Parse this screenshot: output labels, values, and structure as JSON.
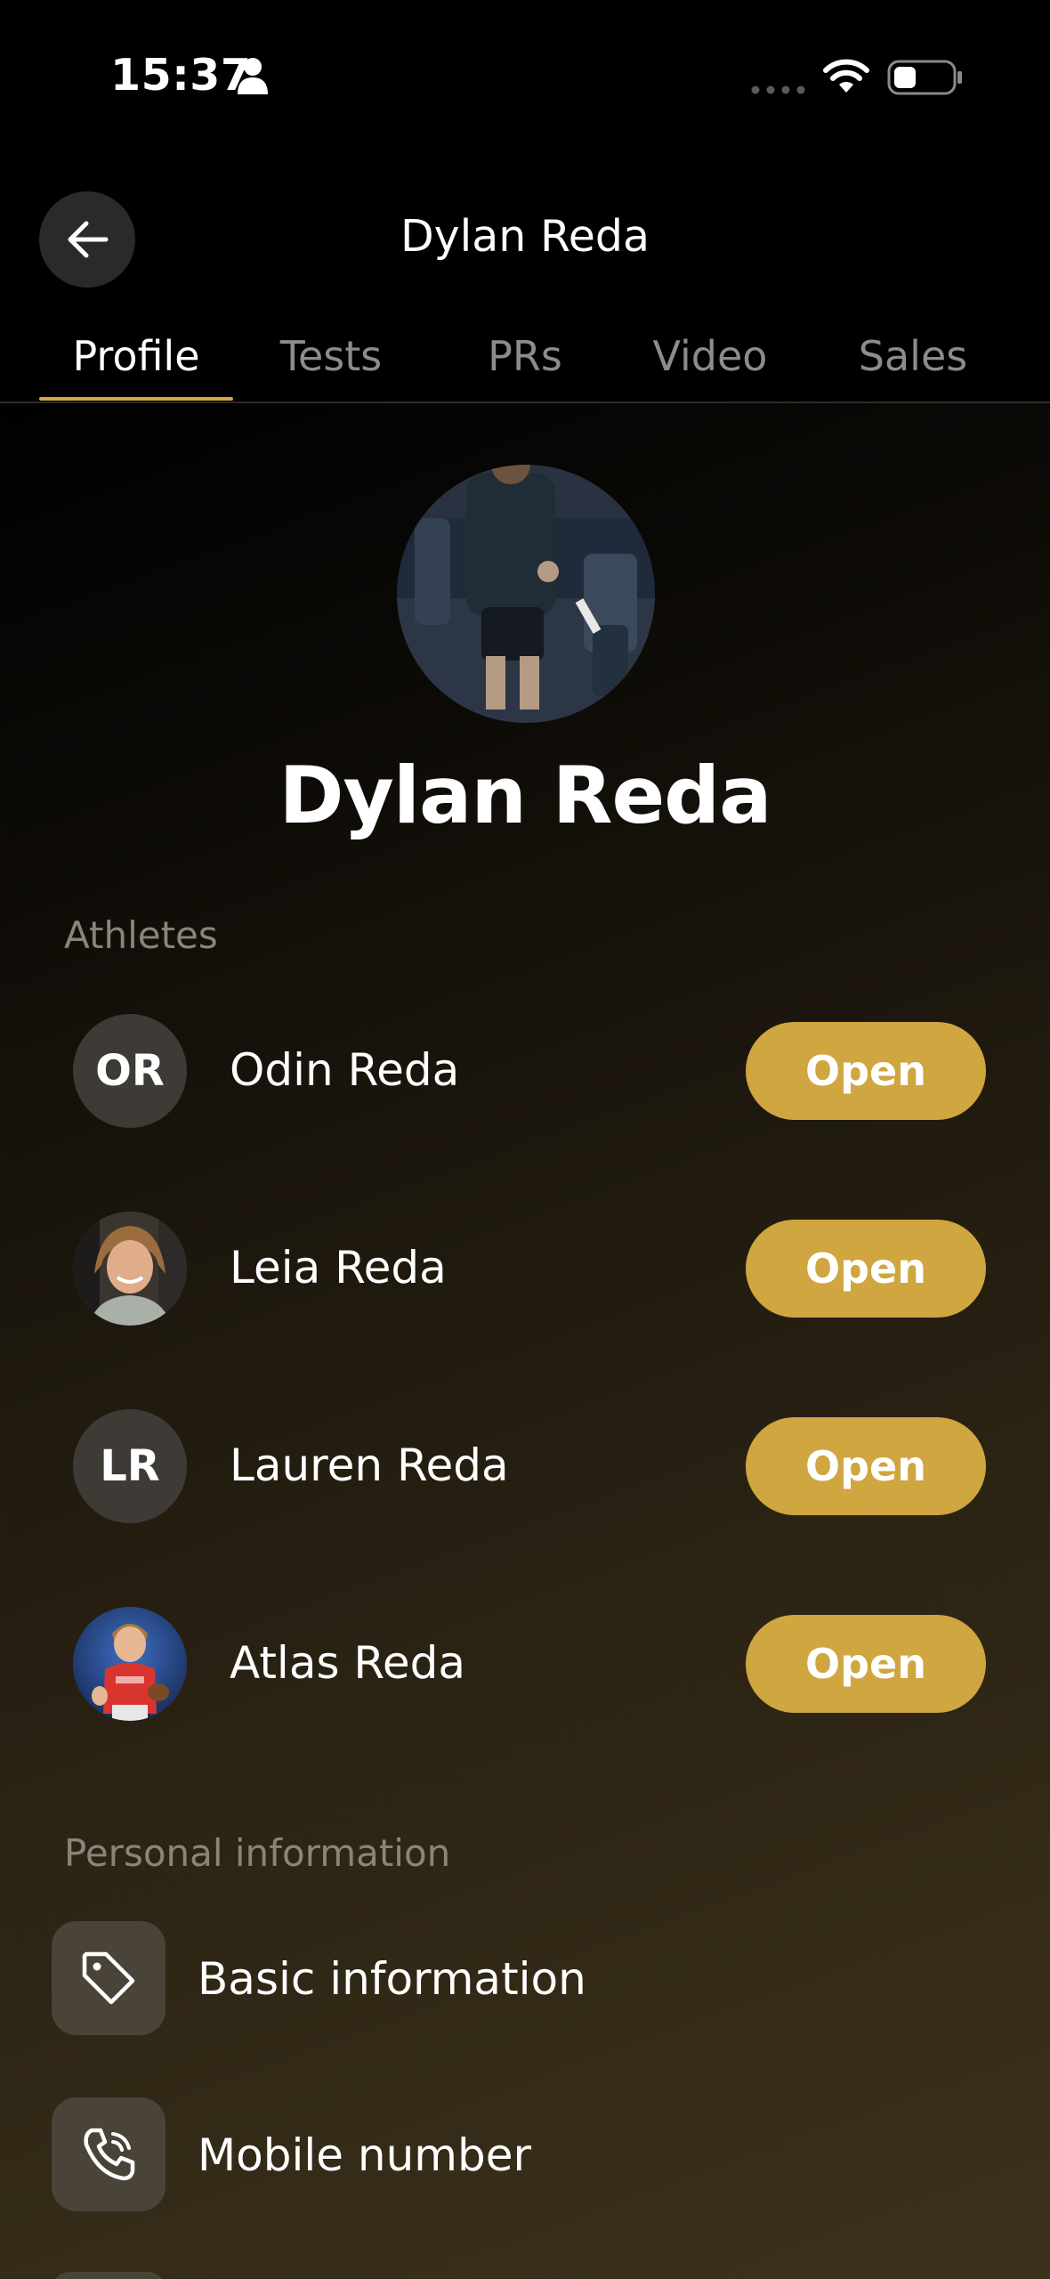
{
  "status_bar": {
    "time": "15:37"
  },
  "nav": {
    "title": "Dylan Reda"
  },
  "tabs": [
    {
      "label": "Profile",
      "active": true
    },
    {
      "label": "Tests",
      "active": false
    },
    {
      "label": "PRs",
      "active": false
    },
    {
      "label": "Video",
      "active": false
    },
    {
      "label": "Sales",
      "active": false
    }
  ],
  "profile": {
    "name": "Dylan Reda"
  },
  "athletes": {
    "heading": "Athletes",
    "open_label": "Open",
    "items": [
      {
        "name": "Odin Reda",
        "initials": "OR",
        "has_photo": false
      },
      {
        "name": "Leia Reda",
        "initials": "",
        "has_photo": true
      },
      {
        "name": "Lauren Reda",
        "initials": "LR",
        "has_photo": false
      },
      {
        "name": "Atlas Reda",
        "initials": "",
        "has_photo": true
      }
    ]
  },
  "personal_info": {
    "heading": "Personal information",
    "items": [
      {
        "label": "Basic information",
        "icon": "tag-icon"
      },
      {
        "label": "Mobile number",
        "icon": "phone-icon"
      }
    ]
  },
  "colors": {
    "accent": "#cfa63f",
    "tab_indicator": "#d4aa47",
    "background_top": "#000000",
    "background_bottom": "#3c321c"
  }
}
